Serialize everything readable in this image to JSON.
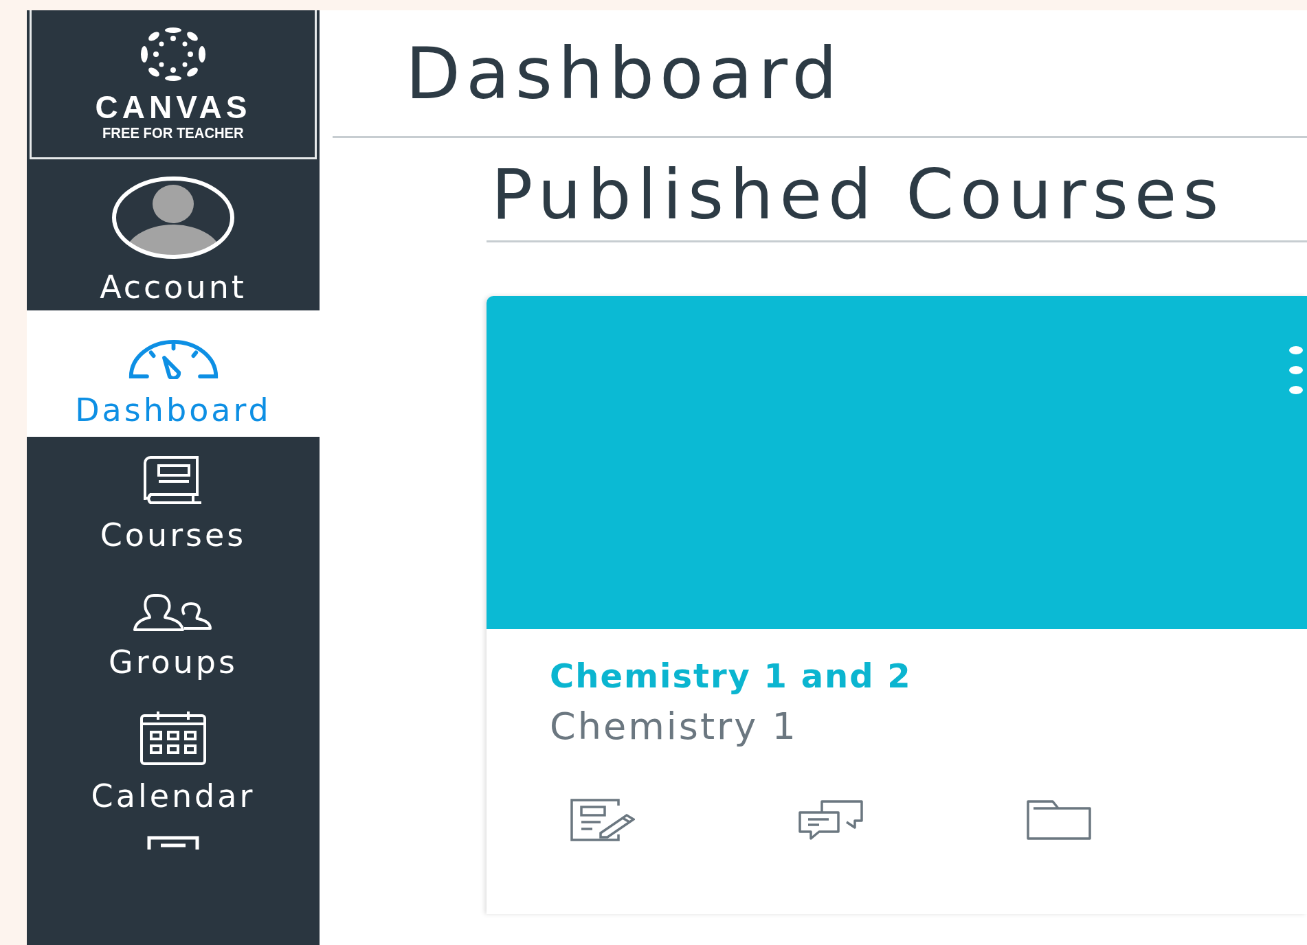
{
  "logo": {
    "name": "CANVAS",
    "tagline": "FREE FOR TEACHER"
  },
  "account": {
    "label": "Account"
  },
  "nav": [
    {
      "kind": "dashboard",
      "label": "Dashboard",
      "selected": true
    },
    {
      "kind": "courses",
      "label": "Courses",
      "selected": false
    },
    {
      "kind": "groups",
      "label": "Groups",
      "selected": false
    },
    {
      "kind": "calendar",
      "label": "Calendar",
      "selected": false
    },
    {
      "kind": "inbox",
      "selected": false
    }
  ],
  "page_title": "Dashboard",
  "section_title": "Published Courses",
  "course_card": {
    "title": "Chemistry 1 and 2",
    "subtitle": "Chemistry 1",
    "actions": [
      {
        "kind": "assignments"
      },
      {
        "kind": "discussions"
      },
      {
        "kind": "files"
      }
    ]
  }
}
